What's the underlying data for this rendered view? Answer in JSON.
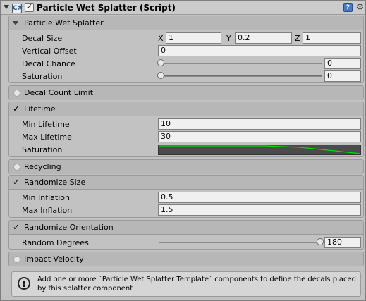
{
  "header": {
    "title": "Particle Wet Splatter (Script)",
    "enabled": true,
    "icons": {
      "script": "script-icon",
      "help": "help-icon",
      "settings": "gear-icon"
    }
  },
  "main": {
    "label": "Particle Wet Splatter",
    "decal_size": {
      "label": "Decal Size",
      "x_label": "X",
      "x": "1",
      "y_label": "Y",
      "y": "0.2",
      "z_label": "Z",
      "z": "1"
    },
    "vertical_offset": {
      "label": "Vertical Offset",
      "value": "0"
    },
    "decal_chance": {
      "label": "Decal Chance",
      "value": "0",
      "slider_fraction": 0
    },
    "saturation": {
      "label": "Saturation",
      "value": "0",
      "slider_fraction": 0
    }
  },
  "decal_count_limit": {
    "label": "Decal Count Limit",
    "enabled": false
  },
  "lifetime": {
    "label": "Lifetime",
    "enabled": true,
    "min": {
      "label": "Min Lifetime",
      "value": "10"
    },
    "max": {
      "label": "Max Lifetime",
      "value": "30"
    },
    "saturation": {
      "label": "Saturation",
      "curve_color": "#00e000",
      "curve_type": "curve-field"
    }
  },
  "recycling": {
    "label": "Recycling",
    "enabled": false
  },
  "randomize_size": {
    "label": "Randomize Size",
    "enabled": true,
    "min": {
      "label": "Min Inflation",
      "value": "0.5"
    },
    "max": {
      "label": "Max Inflation",
      "value": "1.5"
    }
  },
  "randomize_orientation": {
    "label": "Randomize Orientation",
    "enabled": true,
    "degrees": {
      "label": "Random Degrees",
      "value": "180",
      "slider_fraction": 1
    }
  },
  "impact_velocity": {
    "label": "Impact Velocity",
    "enabled": false
  },
  "help": {
    "icon": "info-icon",
    "text": "Add one or more `Particle Wet Splatter Template` components to define the decals placed by this splatter component"
  },
  "colors": {
    "panel": "#c2c2c2",
    "section_header": "#b7b7b7",
    "field": "#f0f0f0"
  }
}
